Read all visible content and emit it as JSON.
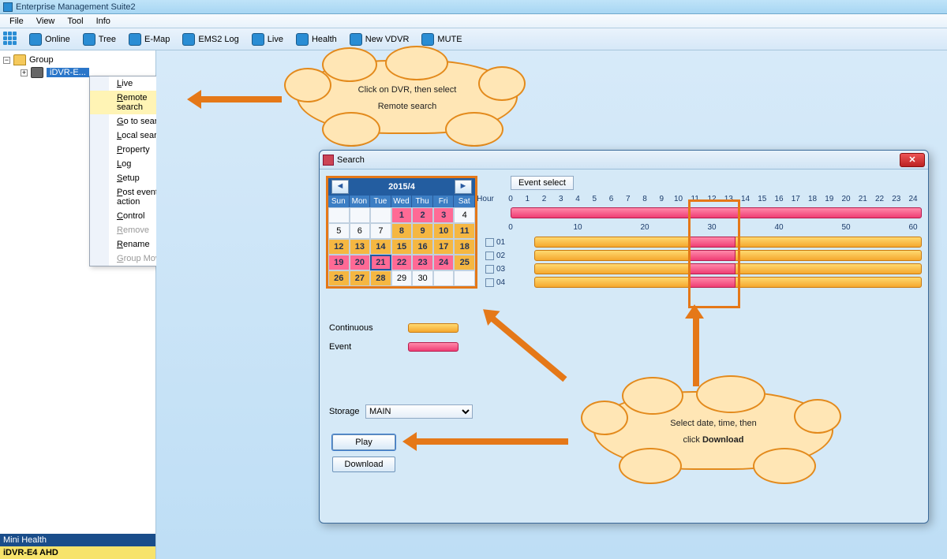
{
  "app": {
    "title": "Enterprise Management Suite2"
  },
  "menu": {
    "items": [
      "File",
      "View",
      "Tool",
      "Info"
    ]
  },
  "toolbar": {
    "buttons": [
      "Online",
      "Tree",
      "E-Map",
      "EMS2 Log",
      "Live",
      "Health",
      "New VDVR",
      "MUTE"
    ]
  },
  "tree": {
    "root": "Group",
    "selected_node": "iDVR-E...",
    "bottom1": "Mini Health",
    "bottom2": "iDVR-E4 AHD"
  },
  "context": {
    "items": [
      {
        "label": "Live",
        "state": ""
      },
      {
        "label": "Remote search",
        "state": "hover"
      },
      {
        "label": "Go to search",
        "state": ""
      },
      {
        "label": "Local search",
        "state": ""
      },
      {
        "label": "Property",
        "state": ""
      },
      {
        "label": "Log",
        "state": ""
      },
      {
        "label": "Setup",
        "state": ""
      },
      {
        "label": "Post event action",
        "state": ""
      },
      {
        "label": "Control",
        "state": "has-sub"
      },
      {
        "label": "Remove",
        "state": "greyed"
      },
      {
        "label": "Rename",
        "state": ""
      },
      {
        "label": "Group Move",
        "state": "greyed"
      }
    ]
  },
  "cloud1": {
    "line1": "Click on DVR, then select",
    "line2": "Remote search"
  },
  "cloud2": {
    "line1": "Select date, time, then",
    "line2_a": "click ",
    "line2_b": "Download"
  },
  "search": {
    "title": "Search",
    "event_select": "Event select",
    "hour_label": "Hour",
    "calendar": {
      "month": "2015/4",
      "dow": [
        "Sun",
        "Mon",
        "Tue",
        "Wed",
        "Thu",
        "Fri",
        "Sat"
      ],
      "cells": [
        {
          "d": "",
          "c": ""
        },
        {
          "d": "",
          "c": ""
        },
        {
          "d": "",
          "c": ""
        },
        {
          "d": "1",
          "c": "rec"
        },
        {
          "d": "2",
          "c": "rec"
        },
        {
          "d": "3",
          "c": "rec"
        },
        {
          "d": "4",
          "c": ""
        },
        {
          "d": "5",
          "c": ""
        },
        {
          "d": "6",
          "c": ""
        },
        {
          "d": "7",
          "c": ""
        },
        {
          "d": "8",
          "c": "cont"
        },
        {
          "d": "9",
          "c": "cont"
        },
        {
          "d": "10",
          "c": "cont"
        },
        {
          "d": "11",
          "c": "cont"
        },
        {
          "d": "12",
          "c": "cont"
        },
        {
          "d": "13",
          "c": "cont"
        },
        {
          "d": "14",
          "c": "cont"
        },
        {
          "d": "15",
          "c": "cont"
        },
        {
          "d": "16",
          "c": "cont"
        },
        {
          "d": "17",
          "c": "cont"
        },
        {
          "d": "18",
          "c": "cont"
        },
        {
          "d": "19",
          "c": "rec"
        },
        {
          "d": "20",
          "c": "rec"
        },
        {
          "d": "21",
          "c": "rec sel"
        },
        {
          "d": "22",
          "c": "rec"
        },
        {
          "d": "23",
          "c": "rec"
        },
        {
          "d": "24",
          "c": "rec"
        },
        {
          "d": "25",
          "c": "cont"
        },
        {
          "d": "26",
          "c": "cont"
        },
        {
          "d": "27",
          "c": "cont"
        },
        {
          "d": "28",
          "c": "cont"
        },
        {
          "d": "29",
          "c": ""
        },
        {
          "d": "30",
          "c": ""
        },
        {
          "d": "",
          "c": ""
        },
        {
          "d": "",
          "c": ""
        }
      ]
    },
    "legend": {
      "continuous": "Continuous",
      "event": "Event"
    },
    "storage": {
      "label": "Storage",
      "value": "MAIN"
    },
    "play": "Play",
    "download": "Download",
    "hours": [
      "0",
      "1",
      "2",
      "3",
      "4",
      "5",
      "6",
      "7",
      "8",
      "9",
      "10",
      "11",
      "12",
      "13",
      "14",
      "15",
      "16",
      "17",
      "18",
      "19",
      "20",
      "21",
      "22",
      "23",
      "24"
    ],
    "minutes": [
      "0",
      "10",
      "20",
      "30",
      "40",
      "50",
      "60"
    ],
    "channels": [
      "01",
      "02",
      "03",
      "04"
    ]
  }
}
